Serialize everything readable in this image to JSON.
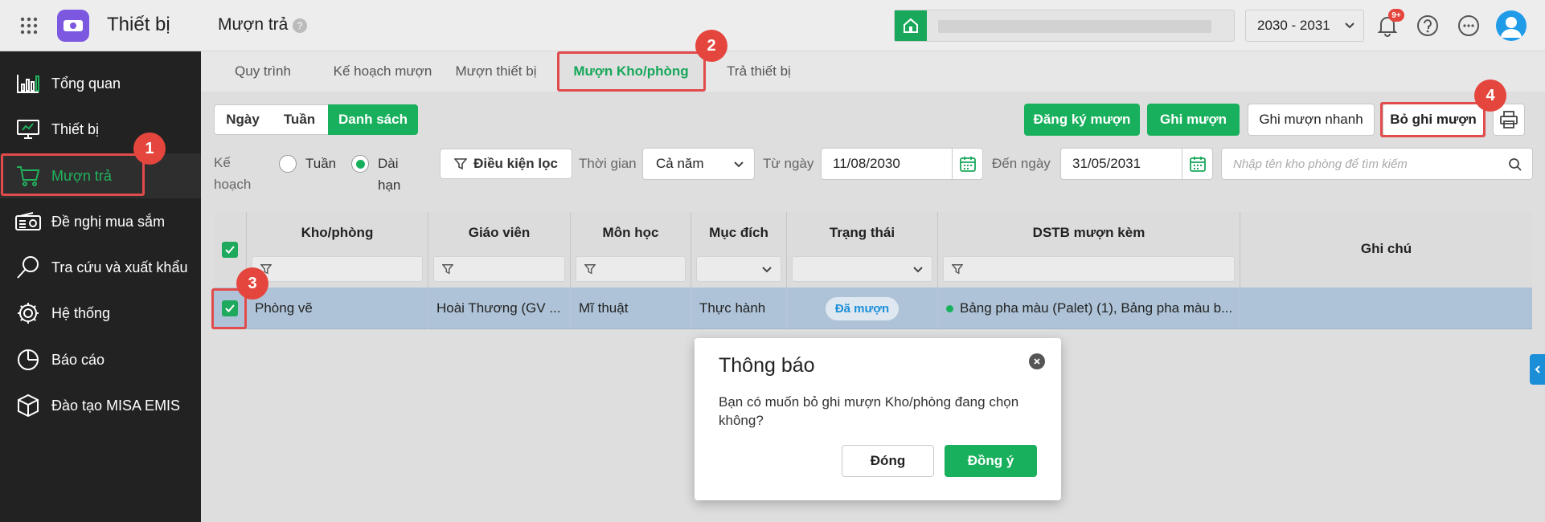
{
  "app": {
    "title": "Thiết bị"
  },
  "header": {
    "page_title": "Mượn trả",
    "help_mark": "?",
    "school_year": "2030 - 2031",
    "notification_count": "9+"
  },
  "sidebar": {
    "items": [
      {
        "label": "Tổng quan",
        "icon": "dashboard-chart-icon"
      },
      {
        "label": "Thiết bị",
        "icon": "monitor-icon"
      },
      {
        "label": "Mượn trả",
        "icon": "cart-icon",
        "active": true
      },
      {
        "label": "Đề nghị mua sắm",
        "icon": "radio-device-icon"
      },
      {
        "label": "Tra cứu và xuất khẩu",
        "icon": "magnifier-icon"
      },
      {
        "label": "Hệ thống",
        "icon": "gear-icon"
      },
      {
        "label": "Báo cáo",
        "icon": "pie-chart-icon"
      },
      {
        "label": "Đào tạo MISA EMIS",
        "icon": "cube-icon"
      }
    ]
  },
  "tabs": [
    {
      "label": "Quy trình"
    },
    {
      "label": "Kế hoạch mượn"
    },
    {
      "label": "Mượn thiết bị"
    },
    {
      "label": "Mượn Kho/phòng",
      "active": true
    },
    {
      "label": "Trả thiết bị"
    }
  ],
  "view_modes": [
    "Ngày",
    "Tuần",
    "Danh sách"
  ],
  "actions": {
    "register": "Đăng ký mượn",
    "record": "Ghi mượn",
    "quick_record": "Ghi mượn nhanh",
    "unrecord": "Bỏ ghi mượn"
  },
  "filters": {
    "plan_label_1": "Kế",
    "plan_label_2": "hoạch",
    "option_week": "Tuần",
    "option_long_1": "Dài",
    "option_long_2": "hạn",
    "filter_button": "Điều kiện lọc",
    "time_label": "Thời gian",
    "time_value": "Cả năm",
    "from_label": "Từ ngày",
    "from_value": "11/08/2030",
    "to_label": "Đến ngày",
    "to_value": "31/05/2031",
    "search_placeholder": "Nhập tên kho phòng để tìm kiếm"
  },
  "table": {
    "columns": [
      "Kho/phòng",
      "Giáo viên",
      "Môn học",
      "Mục đích",
      "Trạng thái",
      "DSTB mượn kèm",
      "Ghi chú"
    ],
    "rows": [
      {
        "room": "Phòng vẽ",
        "teacher": "Hoài Thương (GV ...",
        "subject": "Mĩ thuật",
        "purpose": "Thực hành",
        "status": "Đã mượn",
        "equipment": "Bảng pha màu (Palet) (1), Bảng pha màu b...",
        "note": ""
      }
    ]
  },
  "dialog": {
    "title": "Thông báo",
    "message_line1": "Bạn có muốn bỏ ghi mượn Kho/phòng đang chọn",
    "message_line2": "không?",
    "cancel": "Đóng",
    "confirm": "Đồng ý"
  },
  "annotations": [
    "1",
    "2",
    "3",
    "4"
  ],
  "colors": {
    "accent": "#18b05c",
    "highlight_border": "#e24b4b",
    "sidebar_bg": "#222222",
    "row_selected": "#aec3d7"
  }
}
